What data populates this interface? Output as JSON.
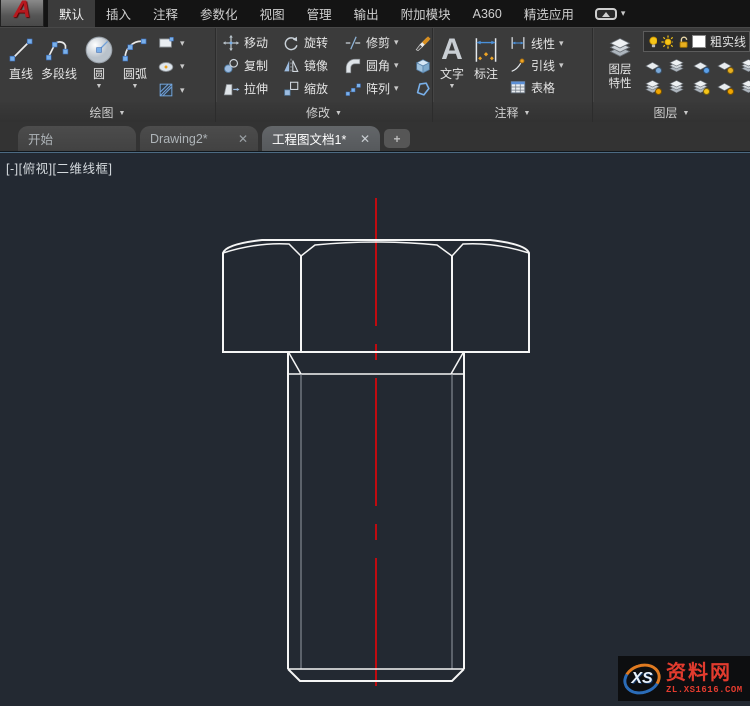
{
  "ribbon_tabs": [
    {
      "label": "默认",
      "active": true
    },
    {
      "label": "插入"
    },
    {
      "label": "注释"
    },
    {
      "label": "参数化"
    },
    {
      "label": "视图"
    },
    {
      "label": "管理"
    },
    {
      "label": "输出"
    },
    {
      "label": "附加模块"
    },
    {
      "label": "A360"
    },
    {
      "label": "精选应用"
    }
  ],
  "panels": {
    "draw": {
      "label": "绘图",
      "tools": [
        {
          "label": "直线"
        },
        {
          "label": "多段线"
        },
        {
          "label": "圆"
        },
        {
          "label": "圆弧"
        }
      ]
    },
    "modify": {
      "label": "修改",
      "tools": [
        {
          "label": "移动"
        },
        {
          "label": "旋转"
        },
        {
          "label": "修剪"
        },
        {
          "label": "复制"
        },
        {
          "label": "镜像"
        },
        {
          "label": "圆角"
        },
        {
          "label": "拉伸"
        },
        {
          "label": "缩放"
        },
        {
          "label": "阵列"
        }
      ]
    },
    "annotate": {
      "label": "注释",
      "tools": [
        {
          "label": "文字"
        },
        {
          "label": "标注"
        },
        {
          "label": "线性"
        },
        {
          "label": "引线"
        },
        {
          "label": "表格"
        }
      ]
    },
    "layers": {
      "label": "图层",
      "properties_line1": "图层",
      "properties_line2": "特性",
      "current_layer": "粗实线"
    }
  },
  "file_tabs": [
    {
      "label": "开始"
    },
    {
      "label": "Drawing2*",
      "closable": true
    },
    {
      "label": "工程图文档1*",
      "active": true,
      "closable": true
    }
  ],
  "viewport_label": "[-][俯视][二维线框]",
  "watermark": {
    "logo_text": "XS",
    "site_name": "资料网",
    "site_url": "ZL.XS1616.COM"
  },
  "colors": {
    "canvas-bg": "#232932",
    "ribbon-bg": "#3b3b3b",
    "tabbar-bg": "#141414",
    "accent-blue": "#4a90d9",
    "centerline-red": "#c00b10",
    "line-white": "#f5f5f5",
    "watermark-red": "#e23b2e",
    "layer-yellow": "#f2c21e"
  }
}
